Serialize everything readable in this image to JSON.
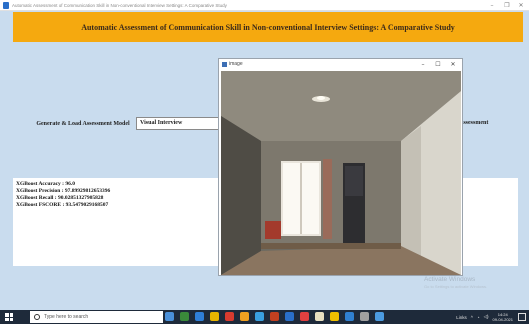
{
  "window": {
    "title": "Automatic Assessment of Communication Skill in Non-conventional Interview Settings: A Comparative Study",
    "controls": {
      "minimize": "–",
      "maximize": "❐",
      "close": "✕"
    }
  },
  "banner": {
    "heading": "Automatic Assessment of Communication Skill in Non-conventional Interview Settings: A Comparative Study"
  },
  "buttons": {
    "generate": "Generate & Load Assessment Model",
    "visual": "Visual Interview",
    "assessment": "Assessment"
  },
  "results": [
    "XGBoost Accuracy : 96.0",
    "XGBoost Precision : 97.89929812653396",
    "XGBoost Recall : 90.02851327905828",
    "XGBoost FSCORE : 93.5479029168507"
  ],
  "image_window": {
    "title": "image",
    "controls": {
      "minimize": "–",
      "maximize": "☐",
      "close": "✕"
    }
  },
  "watermark": {
    "line1": "Activate Windows",
    "line2": "Go to Settings to activate Windows."
  },
  "taskbar": {
    "search_placeholder": "Type here to search",
    "tray_label": "Links",
    "time": "14:24",
    "date": "09-04-2021",
    "app_colors": [
      "#4a90d9",
      "#3a8a3a",
      "#2f7fd8",
      "#e8b400",
      "#d83b2f",
      "#f0a020",
      "#3aa0e0",
      "#c04020",
      "#2a6fc9",
      "#e04040",
      "#e8e0c0",
      "#f0c000",
      "#3080d0",
      "#a0a0a0",
      "#4c9be0"
    ]
  }
}
